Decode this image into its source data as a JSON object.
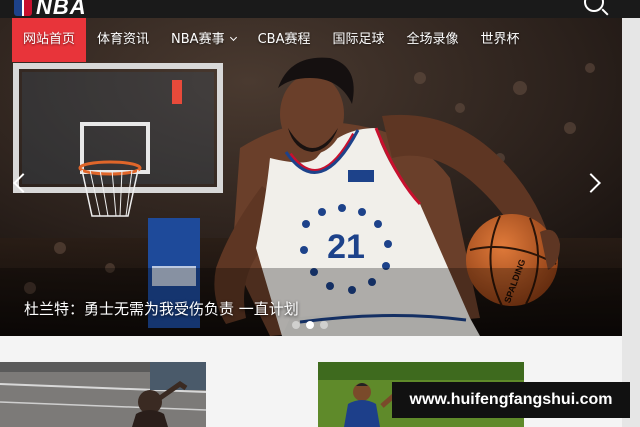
{
  "header": {
    "logo_text": "NBA",
    "logo_icon": "nba-logo-icon",
    "search_icon": "search-icon"
  },
  "nav": {
    "items": [
      {
        "label": "网站首页",
        "active": true
      },
      {
        "label": "体育资讯"
      },
      {
        "label": "NBA赛事",
        "has_dropdown": true
      },
      {
        "label": "CBA赛程"
      },
      {
        "label": "国际足球"
      },
      {
        "label": "全场录像"
      },
      {
        "label": "世界杯"
      }
    ]
  },
  "hero": {
    "caption": "杜兰特：勇士无需为我受伤负责 一直计划",
    "jersey_number": "21",
    "ball_brand": "SPALDING",
    "prev_icon": "chevron-left-icon",
    "next_icon": "chevron-right-icon",
    "slide_count": 3,
    "active_slide": 2
  },
  "watermark": {
    "text": "www.huifengfangshui.com"
  },
  "colors": {
    "accent": "#e8343a",
    "topbar": "#1a1a1a",
    "jersey_trim": "#1d428a"
  }
}
